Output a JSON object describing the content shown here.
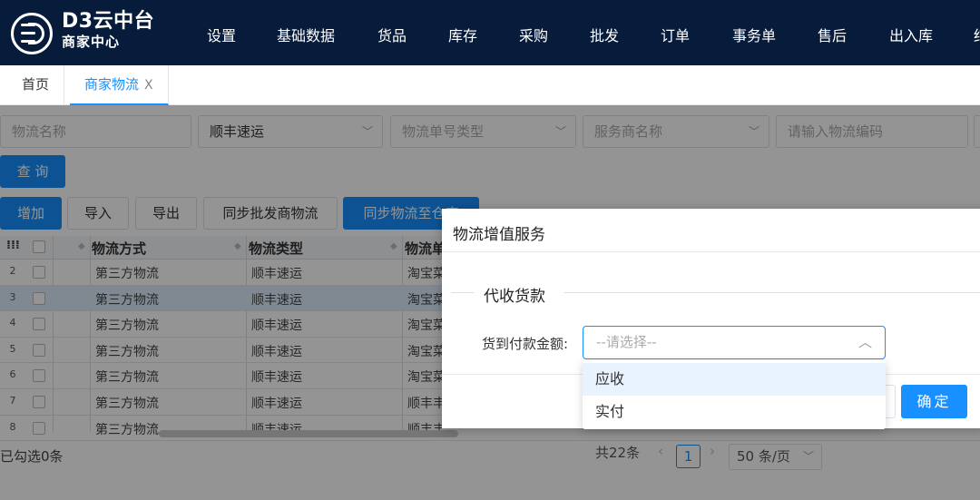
{
  "header": {
    "brand_line1": "D3云中台",
    "brand_line2": "商家中心",
    "nav": [
      "设置",
      "基础数据",
      "货品",
      "库存",
      "采购",
      "批发",
      "订单",
      "事务单",
      "售后",
      "出入库",
      "结"
    ]
  },
  "tabs": {
    "home": "首页",
    "active": "商家物流",
    "close": "X"
  },
  "filters": {
    "logistics_name_placeholder": "物流名称",
    "carrier_value": "顺丰速运",
    "tracking_type_placeholder": "物流单号类型",
    "provider_placeholder": "服务商名称",
    "code_placeholder": "请输入物流编码",
    "query_label": "查 询"
  },
  "toolbar": {
    "add": "增加",
    "import": "导入",
    "export": "导出",
    "sync_wholesale": "同步批发商物流",
    "sync_to": "同步物流至仓库"
  },
  "table": {
    "columns": [
      "物流方式",
      "物流类型",
      "物流单"
    ],
    "rows": [
      {
        "num": "2",
        "method": "第三方物流",
        "type": "顺丰速运",
        "carrier": "淘宝菜"
      },
      {
        "num": "3",
        "method": "第三方物流",
        "type": "顺丰速运",
        "carrier": "淘宝菜"
      },
      {
        "num": "4",
        "method": "第三方物流",
        "type": "顺丰速运",
        "carrier": "淘宝菜"
      },
      {
        "num": "5",
        "method": "第三方物流",
        "type": "顺丰速运",
        "carrier": "淘宝菜"
      },
      {
        "num": "6",
        "method": "第三方物流",
        "type": "顺丰速运",
        "carrier": "淘宝菜"
      },
      {
        "num": "7",
        "method": "第三方物流",
        "type": "顺丰速运",
        "carrier": "顺丰丰"
      },
      {
        "num": "8",
        "method": "第三方物流",
        "type": "顺丰速运",
        "carrier": "顺丰丰"
      }
    ]
  },
  "footer": {
    "selected": "已勾选0条",
    "total": "共22条",
    "page": "1",
    "page_size": "50 条/页"
  },
  "dialog": {
    "title": "物流增值服务",
    "section": "代收货款",
    "field_label": "货到付款金额:",
    "select_placeholder": "--请选择--",
    "options": [
      "应收",
      "实付"
    ],
    "ok": "确定"
  },
  "colors": {
    "topbar": "#071b3a",
    "primary": "#1890ff"
  }
}
